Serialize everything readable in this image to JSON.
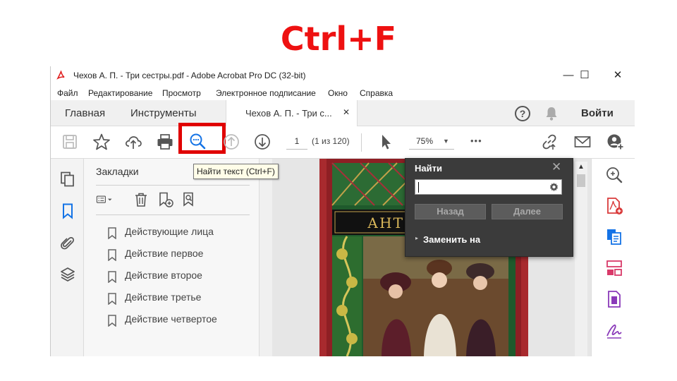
{
  "heading": "Ctrl+F",
  "window": {
    "title": "Чехов А. П. - Три сестры.pdf - Adobe Acrobat Pro DC (32-bit)",
    "controls": {
      "minimize": "—",
      "maximize": "☐",
      "close": "✕"
    }
  },
  "menu": [
    "Файл",
    "Редактирование",
    "Просмотр",
    "Электронное подписание",
    "Окно",
    "Справка"
  ],
  "tabs": {
    "home": "Главная",
    "tools": "Инструменты",
    "document": "Чехов А. П. - Три с...",
    "document_close": "✕",
    "help": "?",
    "sign_in": "Войти"
  },
  "toolbar": {
    "current_page": "1",
    "page_count": "(1 из 120)",
    "zoom": "75%",
    "more": "•••",
    "tooltip": "Найти текст (Ctrl+F)"
  },
  "bookmarks": {
    "title": "Закладки",
    "items": [
      "Действующие лица",
      "Действие первое",
      "Действие второе",
      "Действие третье",
      "Действие четвертое"
    ]
  },
  "find_panel": {
    "title": "Найти",
    "close": "✕",
    "input_value": "",
    "back_label": "Назад",
    "next_label": "Далее",
    "replace_label": "Заменить на",
    "replace_arrow": "▸"
  },
  "cover": {
    "visible_text": "Анто"
  },
  "colors": {
    "heading": "#ee1111",
    "highlight": "#e00000",
    "find_panel_bg": "#3b3b3b",
    "tool_blue": "#1473e6",
    "tool_pink": "#d93a6a",
    "tool_purple": "#8a3ab9"
  },
  "icons": {
    "right_rail": [
      "zoom-icon",
      "create-pdf-icon",
      "export-pdf-icon",
      "organize-pages-icon",
      "edit-pdf-icon",
      "fill-sign-icon"
    ],
    "left_rail": [
      "pages-icon",
      "bookmark-icon",
      "attachments-icon",
      "layers-icon"
    ]
  }
}
